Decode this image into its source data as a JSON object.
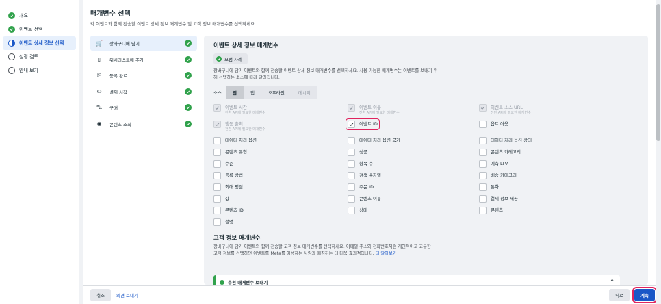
{
  "steps": [
    {
      "label": "개요",
      "state": "done"
    },
    {
      "label": "이벤트 선택",
      "state": "done"
    },
    {
      "label": "이벤트 상세 정보 선택",
      "state": "current"
    },
    {
      "label": "설정 검토",
      "state": "todo"
    },
    {
      "label": "안내 보기",
      "state": "todo"
    }
  ],
  "header": {
    "title": "매개변수 선택",
    "subtitle": "각 이벤트와 함께 전송할 이벤트 상세 정보 매개변수 및 고객 정보 매개변수를 선택하세요."
  },
  "events": [
    {
      "icon": "🛒",
      "icon_name": "cart-icon",
      "label": "장바구니에 담기",
      "selected": true
    },
    {
      "icon": "▯",
      "icon_name": "bookmark-icon",
      "label": "위시리스트에 추가",
      "selected": false
    },
    {
      "icon": "⎘",
      "icon_name": "registration-icon",
      "label": "등록 완료",
      "selected": false
    },
    {
      "icon": "⛀",
      "icon_name": "checkout-icon",
      "label": "결제 시작",
      "selected": false
    },
    {
      "icon": "⛍",
      "icon_name": "purchase-bag-icon",
      "label": "구매",
      "selected": false
    },
    {
      "icon": "◉",
      "icon_name": "view-eye-icon",
      "label": "콘텐츠 조회",
      "selected": false
    }
  ],
  "detail": {
    "title": "이벤트 상세 정보 매개변수",
    "badge": "모범 사례",
    "description": "장바구니에 담기 이벤트와 함께 전송할 이벤트 상세 정보 매개변수를 선택하세요. 사용 가능한 매개변수는 이벤트를 보내기 위해 선택하는 소스에 따라 달라집니다.",
    "source_label": "소스",
    "sources": [
      {
        "label": "웹",
        "state": "on"
      },
      {
        "label": "앱",
        "state": "normal"
      },
      {
        "label": "오프라인",
        "state": "normal"
      },
      {
        "label": "메시지",
        "state": "off"
      }
    ],
    "params": [
      {
        "label": "이벤트 시간",
        "sub": "전환 API에 필요한 매개변수",
        "checked": true,
        "disabled": true
      },
      {
        "label": "이벤트 이름",
        "sub": "전환 API에 필요한 매개변수",
        "checked": true,
        "disabled": true
      },
      {
        "label": "이벤트 소스 URL",
        "sub": "전환 API에 필요한 매개변수",
        "checked": true,
        "disabled": true
      },
      {
        "label": "행동 출처",
        "sub": "전환 API에 필요한 매개변수",
        "checked": true,
        "disabled": true
      },
      {
        "label": "이벤트 ID",
        "sub": "",
        "checked": true,
        "disabled": false,
        "highlight": true
      },
      {
        "label": "옵트 아웃",
        "sub": "",
        "checked": false,
        "disabled": false
      },
      {
        "label": "데이터 처리 옵션",
        "sub": "",
        "checked": false,
        "disabled": false
      },
      {
        "label": "데이터 처리 옵션 국가",
        "sub": "",
        "checked": false,
        "disabled": false
      },
      {
        "label": "데이터 처리 옵션 상태",
        "sub": "",
        "checked": false,
        "disabled": false
      },
      {
        "label": "콘텐츠 유형",
        "sub": "",
        "checked": false,
        "disabled": false
      },
      {
        "label": "성공",
        "sub": "",
        "checked": false,
        "disabled": false
      },
      {
        "label": "콘텐츠 카테고리",
        "sub": "",
        "checked": false,
        "disabled": false
      },
      {
        "label": "수준",
        "sub": "",
        "checked": false,
        "disabled": false
      },
      {
        "label": "항목 수",
        "sub": "",
        "checked": false,
        "disabled": false
      },
      {
        "label": "예측 LTV",
        "sub": "",
        "checked": false,
        "disabled": false
      },
      {
        "label": "등록 방법",
        "sub": "",
        "checked": false,
        "disabled": false
      },
      {
        "label": "검색 문자열",
        "sub": "",
        "checked": false,
        "disabled": false
      },
      {
        "label": "배송 카테고리",
        "sub": "",
        "checked": false,
        "disabled": false
      },
      {
        "label": "최대 평점",
        "sub": "",
        "checked": false,
        "disabled": false
      },
      {
        "label": "주문 ID",
        "sub": "",
        "checked": false,
        "disabled": false
      },
      {
        "label": "통화",
        "sub": "",
        "checked": false,
        "disabled": false
      },
      {
        "label": "값",
        "sub": "",
        "checked": false,
        "disabled": false
      },
      {
        "label": "콘텐츠 이름",
        "sub": "",
        "checked": false,
        "disabled": false
      },
      {
        "label": "결제 정보 제공",
        "sub": "",
        "checked": false,
        "disabled": false
      },
      {
        "label": "콘텐츠 ID",
        "sub": "",
        "checked": false,
        "disabled": false
      },
      {
        "label": "상태",
        "sub": "",
        "checked": false,
        "disabled": false
      },
      {
        "label": "콘텐츠",
        "sub": "",
        "checked": false,
        "disabled": false
      },
      {
        "label": "설명",
        "sub": "",
        "checked": false,
        "disabled": false
      }
    ],
    "customer_title": "고객 정보 매개변수",
    "customer_desc": "장바구니에 담기 이벤트와 함께 전송할 고객 정보 매개변수를 선택하세요. 이메일 주소와 전화번호처럼 개인적이고 고유한 고객 정보를 선택하면 이벤트를 Meta를 이용하는 사람과 매칭하는 데 더욱 효과적입니다.",
    "learn_more": "더 알아보기",
    "recommended": "추천 매개변수 보내기",
    "chevron": "⌃"
  },
  "footer": {
    "cancel": "취소",
    "feedback": "의견 보내기",
    "back": "뒤로",
    "continue": "계속"
  },
  "colors": {
    "primary": "#1a57c7",
    "success": "#31a24c",
    "highlight": "#e0245e"
  }
}
